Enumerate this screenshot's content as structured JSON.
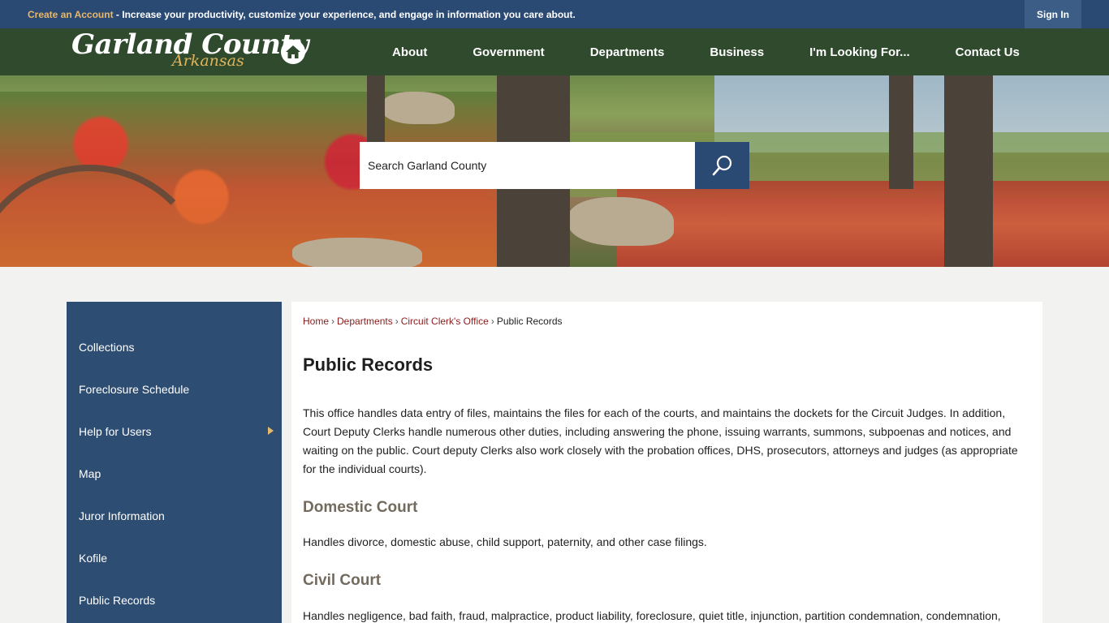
{
  "topbar": {
    "create_account": "Create an Account",
    "message": " - Increase your productivity, customize your experience, and engage in information you care about.",
    "sign_in": "Sign In"
  },
  "logo": {
    "line1": "Garland County",
    "line2": "Arkansas"
  },
  "nav": [
    {
      "label": "About"
    },
    {
      "label": "Government"
    },
    {
      "label": "Departments"
    },
    {
      "label": "Business"
    },
    {
      "label": "I'm Looking For..."
    },
    {
      "label": "Contact Us"
    }
  ],
  "search": {
    "placeholder": "Search Garland County"
  },
  "sidebar": {
    "items": [
      {
        "label": "Collections"
      },
      {
        "label": "Foreclosure Schedule"
      },
      {
        "label": "Help for Users"
      },
      {
        "label": "Map"
      },
      {
        "label": "Juror Information"
      },
      {
        "label": "Kofile"
      },
      {
        "label": "Public Records"
      }
    ]
  },
  "breadcrumb": {
    "home": "Home",
    "departments": "Departments",
    "circuit_clerk": "Circuit Clerk's Office",
    "current": "Public Records",
    "separator": "›"
  },
  "page": {
    "title": "Public Records",
    "intro": "This office handles data entry of files, maintains the files for each of the courts, and maintains the dockets for the Circuit Judges. In addition, Court Deputy Clerks handle numerous other duties, including answering the phone, issuing warrants, summons, subpoenas and notices, and waiting on the public. Court deputy Clerks also work closely with the probation offices, DHS, prosecutors, attorneys and judges (as appropriate for the individual courts).",
    "domestic_heading": "Domestic Court",
    "domestic_text": "Handles divorce, domestic abuse, child support, paternity, and other case filings.",
    "civil_heading": "Civil Court",
    "civil_text": "Handles negligence, bad faith, fraud, malpractice, product liability, foreclosure, quiet title, injunction, partition condemnation, condemnation,"
  },
  "colors": {
    "topbar": "#2b4a73",
    "header": "#2f4a2c",
    "sidebar": "#2e4d73",
    "accent": "#e8b86a",
    "link": "#8a1c1c"
  },
  "icons": [
    "home-icon",
    "search-icon",
    "arrow-right-icon"
  ]
}
